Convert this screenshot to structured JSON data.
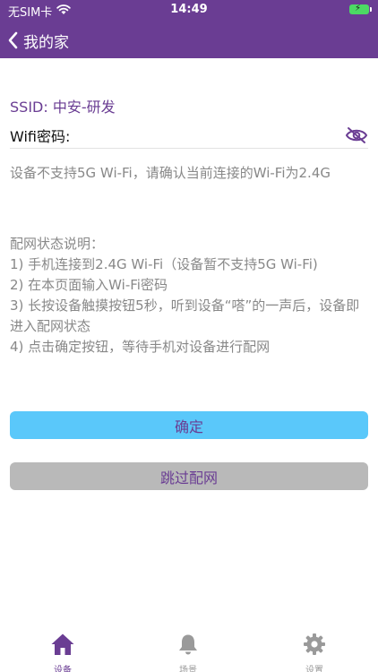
{
  "status_bar": {
    "carrier": "无SIM卡",
    "time": "14:49"
  },
  "nav": {
    "title": "我的家"
  },
  "form": {
    "ssid_prefix": "SSID: ",
    "ssid_value": "中安-研发",
    "password_label": "Wifi密码:",
    "password_value": "",
    "password_placeholder": ""
  },
  "tip": "设备不支持5G Wi-Fi，请确认当前连接的Wi-Fi为2.4G",
  "instructions": {
    "title": "配网状态说明：",
    "steps": [
      "1) 手机连接到2.4G Wi-Fi（设备暂不支持5G Wi-Fi)",
      "2) 在本页面输入Wi-Fi密码",
      "3) 长按设备触摸按钮5秒，听到设备“嗒”的一声后，设备即进入配网状态",
      "4) 点击确定按钮，等待手机对设备进行配网"
    ]
  },
  "buttons": {
    "confirm": "确定",
    "skip": "跳过配网"
  },
  "tabs": [
    {
      "label": "设备",
      "icon": "home-icon",
      "active": true
    },
    {
      "label": "场景",
      "icon": "bell-icon",
      "active": false
    },
    {
      "label": "设置",
      "icon": "gear-icon",
      "active": false
    }
  ],
  "colors": {
    "brand": "#6a3d93",
    "confirm_bg": "#5ac8fa",
    "skip_bg": "#b9b9b9",
    "battery": "#4cd964"
  }
}
